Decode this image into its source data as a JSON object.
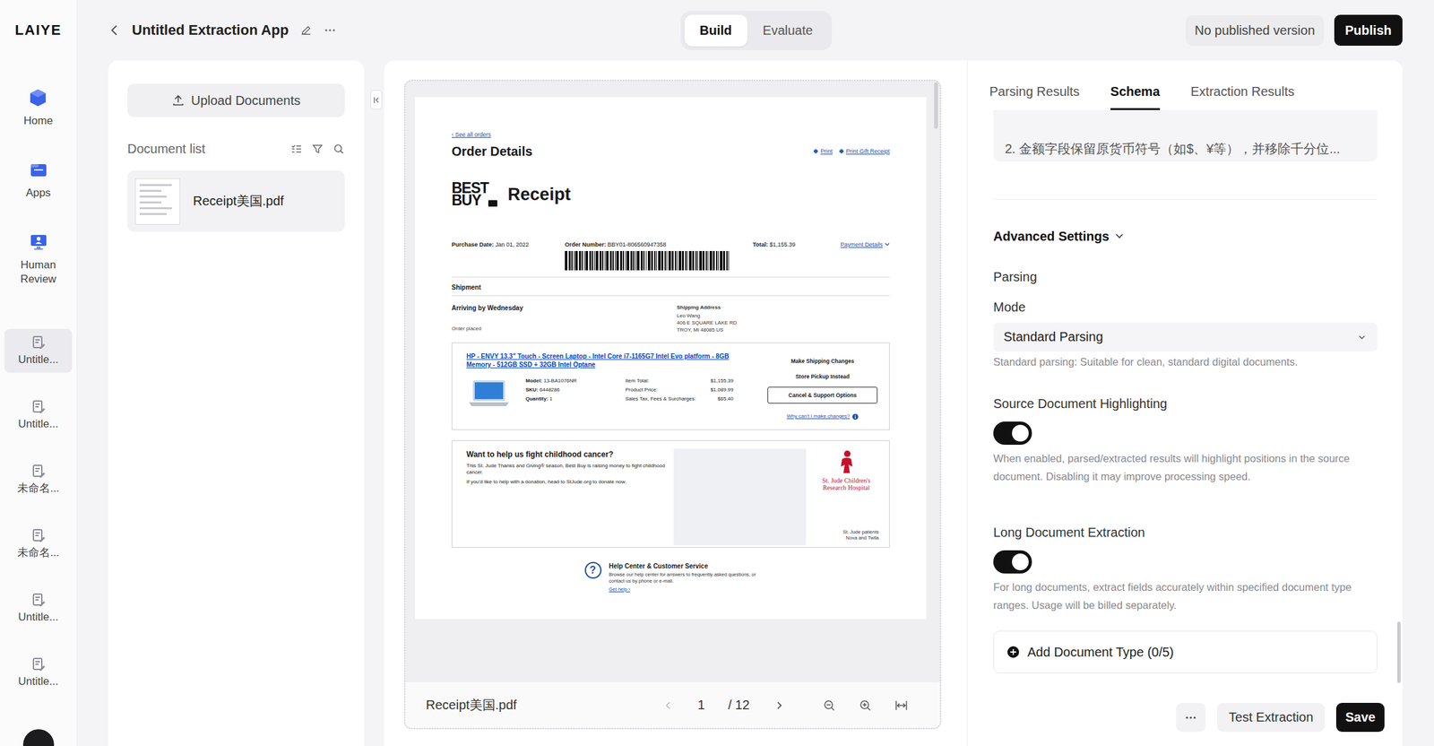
{
  "rail": {
    "logo": "LAIYE",
    "nav": [
      {
        "label": "Home"
      },
      {
        "label": "Apps"
      },
      {
        "label": "Human Review"
      }
    ],
    "apps": [
      {
        "label": "Untitle...",
        "selected": true
      },
      {
        "label": "Untitle...",
        "selected": false
      },
      {
        "label": "未命名...",
        "selected": false
      },
      {
        "label": "未命名...",
        "selected": false
      },
      {
        "label": "Untitle...",
        "selected": false
      },
      {
        "label": "Untitle...",
        "selected": false
      }
    ]
  },
  "header": {
    "title": "Untitled Extraction App",
    "modes": [
      {
        "label": "Build",
        "selected": true
      },
      {
        "label": "Evaluate",
        "selected": false
      }
    ],
    "status": "No published version",
    "publish": "Publish"
  },
  "documents": {
    "upload": "Upload Documents",
    "title": "Document list",
    "items": [
      {
        "name": "Receipt美国.pdf",
        "selected": true
      }
    ]
  },
  "viewer": {
    "file": "Receipt美国.pdf",
    "page": "1",
    "total": "/ 12",
    "document": {
      "back_link": "‹ See all orders",
      "heading": "Order Details",
      "links": [
        "Print",
        "Print Gift Receipt"
      ],
      "brand": [
        "BEST",
        "BUY"
      ],
      "title": "Receipt",
      "summary": [
        {
          "label": "Purchase Date:",
          "value": "Jan 01, 2022"
        },
        {
          "label": "Order Number:",
          "value": "BBY01-806560947358"
        },
        {
          "label": "Total:",
          "value": "$1,155.39"
        }
      ],
      "payment_link": "Payment Details",
      "section": "Shipment",
      "arrival": "Arriving by Wednesday",
      "placed": "Order placed",
      "address_title": "Shipping Address",
      "address": [
        "Leo Wang",
        "406 E SQUARE LAKE RD",
        "TROY, MI  48085 US"
      ],
      "item": {
        "name": "HP - ENVY 13.3\" Touch - Screen Laptop - Intel Core i7-1165G7 Intel Evo platform - 8GB Memory - 512GB SSD + 32GB Intel Optane",
        "specs": [
          {
            "label": "Model:",
            "value": "13-BA1076NR"
          },
          {
            "label": "SKU:",
            "value": "6448286"
          },
          {
            "label": "Quantity:",
            "value": "1"
          }
        ],
        "prices": [
          {
            "label": "Item Total:",
            "value": "$1,155.39"
          },
          {
            "label": "Product Price:",
            "value": "$1,089.99"
          },
          {
            "label": "Sales Tax, Fees & Surcharges:",
            "value": "$65.40"
          }
        ],
        "actions": [
          {
            "label": "Make Shipping Changes",
            "kind": "link"
          },
          {
            "label": "Store Pickup Instead",
            "kind": "link"
          },
          {
            "label": "Cancel & Support Options",
            "kind": "button"
          }
        ],
        "help": "Why can't I make changes?"
      },
      "promo": {
        "heading": "Want to help us fight childhood cancer?",
        "body": [
          "This St. Jude Thanks and Giving® season, Best Buy is raising money to fight childhood cancer.",
          "If you'd like to help with a donation, head to StJude.org to donate now."
        ],
        "org": [
          "St. Jude Children's",
          "Research Hospital"
        ],
        "caption": [
          "St. Jude patients",
          "Nova and Twila"
        ]
      },
      "support": {
        "icon": "?",
        "heading": "Help Center & Customer Service",
        "body": "Browse our help center for answers to frequently asked questions, or contact us by phone or e-mail.",
        "link": "Get help ›"
      }
    }
  },
  "panel": {
    "tabs": [
      {
        "label": "Parsing Results",
        "selected": false
      },
      {
        "label": "Schema",
        "selected": true
      },
      {
        "label": "Extraction Results",
        "selected": false
      }
    ],
    "prompt": "2. 金额字段保留原货币符号（如$、¥等），并移除千分位...",
    "advanced": {
      "title": "Advanced Settings",
      "expanded": true
    },
    "group": "Parsing",
    "mode": {
      "label": "Mode",
      "value": "Standard Parsing",
      "help": "Standard parsing: Suitable for clean, standard digital documents."
    },
    "toggles": [
      {
        "label": "Source Document Highlighting",
        "on": true,
        "help": "When enabled, parsed/extracted results will highlight positions in the source document. Disabling it may improve processing speed."
      },
      {
        "label": "Long Document Extraction",
        "on": true,
        "help": "For long documents, extract fields accurately within specified document type ranges. Usage will be billed separately."
      }
    ],
    "add": "Add Document Type (0/5)",
    "test": "Test Extraction",
    "save": "Save"
  }
}
